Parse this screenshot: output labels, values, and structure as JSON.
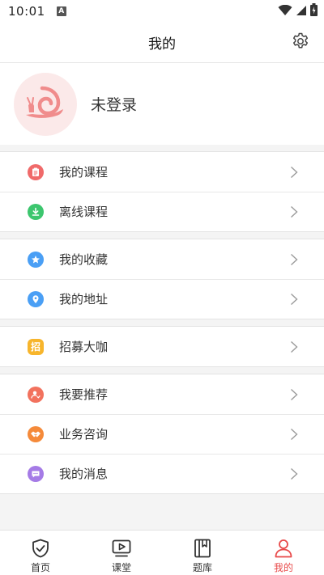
{
  "status_bar": {
    "time": "10:01",
    "indicator_letter": "A"
  },
  "header": {
    "title": "我的",
    "settings_icon": "gear-icon"
  },
  "profile": {
    "avatar_icon": "snail-icon",
    "login_text": "未登录"
  },
  "menu_groups": [
    {
      "items": [
        {
          "label": "我的课程",
          "icon": "clipboard-icon",
          "color": "#f06a6a"
        },
        {
          "label": "离线课程",
          "icon": "download-icon",
          "color": "#3cc66e"
        }
      ]
    },
    {
      "items": [
        {
          "label": "我的收藏",
          "icon": "star-icon",
          "color": "#4a9ff5"
        },
        {
          "label": "我的地址",
          "icon": "location-pin-icon",
          "color": "#4a9ff5"
        }
      ]
    },
    {
      "items": [
        {
          "label": "招募大咖",
          "icon": "recruit-icon",
          "glyph": "招",
          "color": "#f7b52c"
        }
      ]
    },
    {
      "items": [
        {
          "label": "我要推荐",
          "icon": "recommend-user-icon",
          "color": "#f2725e"
        },
        {
          "label": "业务咨询",
          "icon": "handshake-icon",
          "color": "#f58a3a"
        },
        {
          "label": "我的消息",
          "icon": "message-icon",
          "color": "#a57be6"
        }
      ]
    }
  ],
  "tab_bar": {
    "active_color": "#e84a4a",
    "tabs": [
      {
        "label": "首页",
        "icon": "shield-check-icon",
        "active": false
      },
      {
        "label": "课堂",
        "icon": "video-play-icon",
        "active": false
      },
      {
        "label": "题库",
        "icon": "book-icon",
        "active": false
      },
      {
        "label": "我的",
        "icon": "user-icon",
        "active": true
      }
    ]
  }
}
